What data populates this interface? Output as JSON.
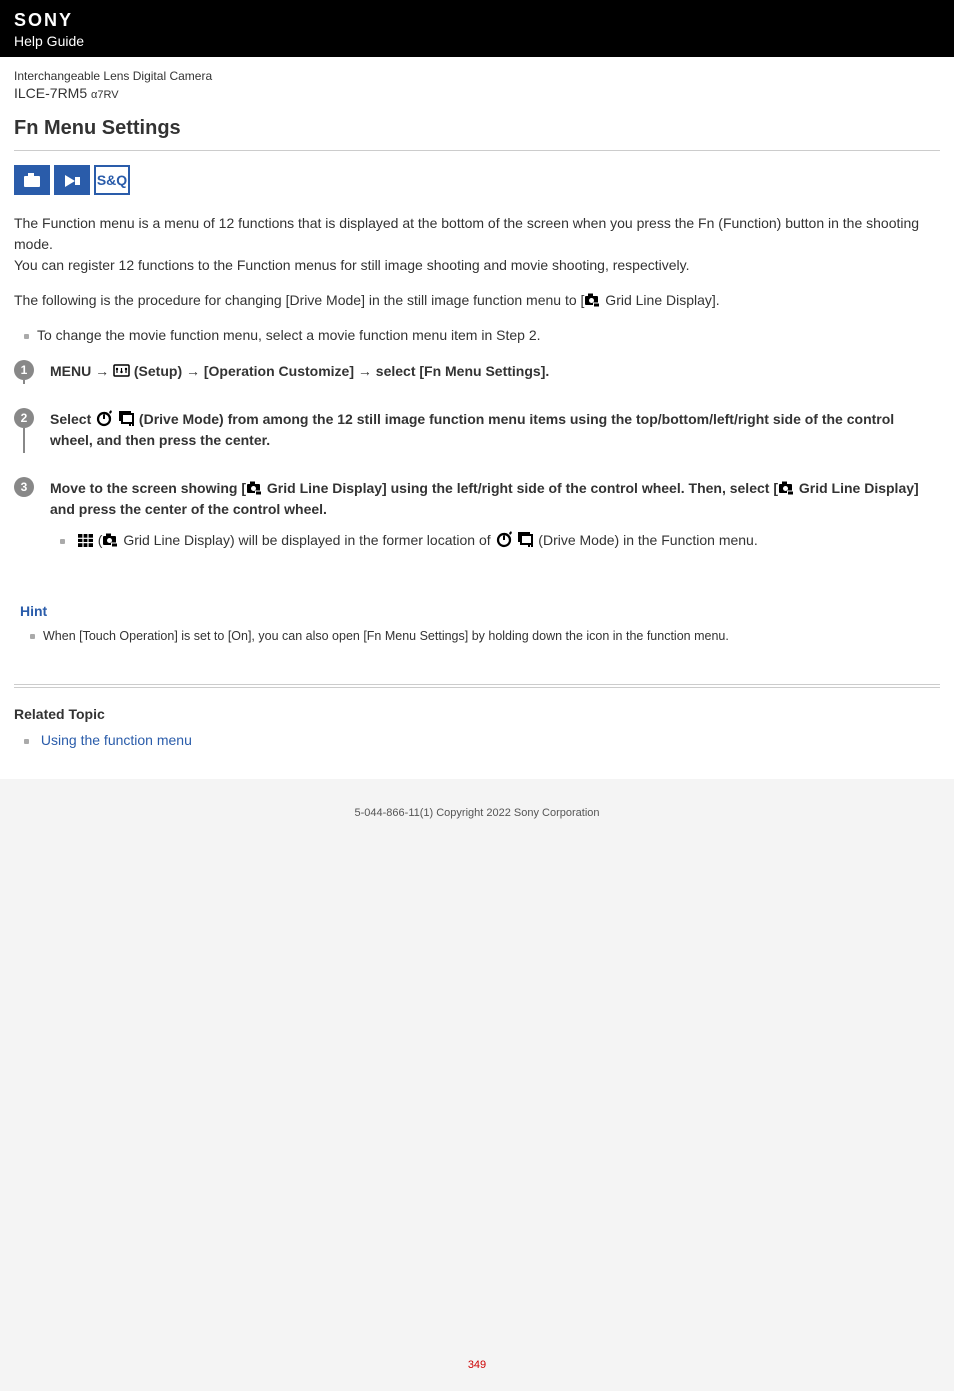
{
  "header": {
    "brand": "SONY",
    "guide": "Help Guide"
  },
  "product": {
    "desc": "Interchangeable Lens Digital Camera",
    "model": "ILCE-7RM5",
    "alpha": "α7RV"
  },
  "title": "Fn Menu Settings",
  "mode_icons": {
    "sq_label": "S&Q"
  },
  "paragraphs": {
    "p1a": "The Function menu is a menu of 12 functions that is displayed at the bottom of the screen when you press the Fn (Function) button in the shooting mode.",
    "p1b": "You can register 12 functions to the Function menus for still image shooting and movie shooting, respectively.",
    "p2a": "The following is the procedure for changing [Drive Mode] in the still image function menu to [",
    "p2b": " Grid Line Display].",
    "bullet1": "To change the movie function menu, select a movie function menu item in Step 2."
  },
  "steps": {
    "s1": {
      "num": "1",
      "a": "MENU → ",
      "b": " (Setup) → [Operation Customize] → select [Fn Menu Settings]."
    },
    "s2": {
      "num": "2",
      "a": "Select ",
      "b": " (Drive Mode) from among the 12 still image function menu items using the top/bottom/left/right side of the control wheel, and then press the center."
    },
    "s3": {
      "num": "3",
      "a": "Move to the screen showing [",
      "b": " Grid Line Display] using the left/right side of the control wheel. Then, select [",
      "c": " Grid Line Display] and press the center of the control wheel.",
      "sub_a": " (",
      "sub_b": " Grid Line Display) will be displayed in the former location of ",
      "sub_c": " (Drive Mode) in the Function menu."
    }
  },
  "hint": {
    "title": "Hint",
    "text": "When [Touch Operation] is set to [On], you can also open [Fn Menu Settings] by holding down the icon in the function menu."
  },
  "related": {
    "title": "Related Topic",
    "link": "Using the function menu"
  },
  "footer": {
    "copyright": "5-044-866-11(1) Copyright 2022 Sony Corporation",
    "page": "349"
  }
}
